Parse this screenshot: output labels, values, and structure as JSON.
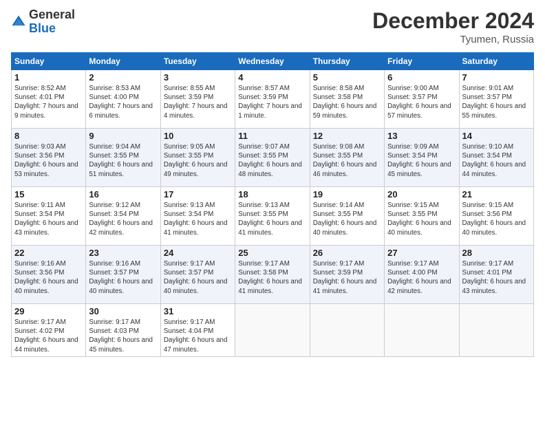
{
  "header": {
    "logo_general": "General",
    "logo_blue": "Blue",
    "month_title": "December 2024",
    "location": "Tyumen, Russia"
  },
  "days_of_week": [
    "Sunday",
    "Monday",
    "Tuesday",
    "Wednesday",
    "Thursday",
    "Friday",
    "Saturday"
  ],
  "weeks": [
    [
      {
        "day": "1",
        "sunrise": "8:52 AM",
        "sunset": "4:01 PM",
        "daylight": "7 hours and 9 minutes."
      },
      {
        "day": "2",
        "sunrise": "8:53 AM",
        "sunset": "4:00 PM",
        "daylight": "7 hours and 6 minutes."
      },
      {
        "day": "3",
        "sunrise": "8:55 AM",
        "sunset": "3:59 PM",
        "daylight": "7 hours and 4 minutes."
      },
      {
        "day": "4",
        "sunrise": "8:57 AM",
        "sunset": "3:59 PM",
        "daylight": "7 hours and 1 minute."
      },
      {
        "day": "5",
        "sunrise": "8:58 AM",
        "sunset": "3:58 PM",
        "daylight": "6 hours and 59 minutes."
      },
      {
        "day": "6",
        "sunrise": "9:00 AM",
        "sunset": "3:57 PM",
        "daylight": "6 hours and 57 minutes."
      },
      {
        "day": "7",
        "sunrise": "9:01 AM",
        "sunset": "3:57 PM",
        "daylight": "6 hours and 55 minutes."
      }
    ],
    [
      {
        "day": "8",
        "sunrise": "9:03 AM",
        "sunset": "3:56 PM",
        "daylight": "6 hours and 53 minutes."
      },
      {
        "day": "9",
        "sunrise": "9:04 AM",
        "sunset": "3:55 PM",
        "daylight": "6 hours and 51 minutes."
      },
      {
        "day": "10",
        "sunrise": "9:05 AM",
        "sunset": "3:55 PM",
        "daylight": "6 hours and 49 minutes."
      },
      {
        "day": "11",
        "sunrise": "9:07 AM",
        "sunset": "3:55 PM",
        "daylight": "6 hours and 48 minutes."
      },
      {
        "day": "12",
        "sunrise": "9:08 AM",
        "sunset": "3:55 PM",
        "daylight": "6 hours and 46 minutes."
      },
      {
        "day": "13",
        "sunrise": "9:09 AM",
        "sunset": "3:54 PM",
        "daylight": "6 hours and 45 minutes."
      },
      {
        "day": "14",
        "sunrise": "9:10 AM",
        "sunset": "3:54 PM",
        "daylight": "6 hours and 44 minutes."
      }
    ],
    [
      {
        "day": "15",
        "sunrise": "9:11 AM",
        "sunset": "3:54 PM",
        "daylight": "6 hours and 43 minutes."
      },
      {
        "day": "16",
        "sunrise": "9:12 AM",
        "sunset": "3:54 PM",
        "daylight": "6 hours and 42 minutes."
      },
      {
        "day": "17",
        "sunrise": "9:13 AM",
        "sunset": "3:54 PM",
        "daylight": "6 hours and 41 minutes."
      },
      {
        "day": "18",
        "sunrise": "9:13 AM",
        "sunset": "3:55 PM",
        "daylight": "6 hours and 41 minutes."
      },
      {
        "day": "19",
        "sunrise": "9:14 AM",
        "sunset": "3:55 PM",
        "daylight": "6 hours and 40 minutes."
      },
      {
        "day": "20",
        "sunrise": "9:15 AM",
        "sunset": "3:55 PM",
        "daylight": "6 hours and 40 minutes."
      },
      {
        "day": "21",
        "sunrise": "9:15 AM",
        "sunset": "3:56 PM",
        "daylight": "6 hours and 40 minutes."
      }
    ],
    [
      {
        "day": "22",
        "sunrise": "9:16 AM",
        "sunset": "3:56 PM",
        "daylight": "6 hours and 40 minutes."
      },
      {
        "day": "23",
        "sunrise": "9:16 AM",
        "sunset": "3:57 PM",
        "daylight": "6 hours and 40 minutes."
      },
      {
        "day": "24",
        "sunrise": "9:17 AM",
        "sunset": "3:57 PM",
        "daylight": "6 hours and 40 minutes."
      },
      {
        "day": "25",
        "sunrise": "9:17 AM",
        "sunset": "3:58 PM",
        "daylight": "6 hours and 41 minutes."
      },
      {
        "day": "26",
        "sunrise": "9:17 AM",
        "sunset": "3:59 PM",
        "daylight": "6 hours and 41 minutes."
      },
      {
        "day": "27",
        "sunrise": "9:17 AM",
        "sunset": "4:00 PM",
        "daylight": "6 hours and 42 minutes."
      },
      {
        "day": "28",
        "sunrise": "9:17 AM",
        "sunset": "4:01 PM",
        "daylight": "6 hours and 43 minutes."
      }
    ],
    [
      {
        "day": "29",
        "sunrise": "9:17 AM",
        "sunset": "4:02 PM",
        "daylight": "6 hours and 44 minutes."
      },
      {
        "day": "30",
        "sunrise": "9:17 AM",
        "sunset": "4:03 PM",
        "daylight": "6 hours and 45 minutes."
      },
      {
        "day": "31",
        "sunrise": "9:17 AM",
        "sunset": "4:04 PM",
        "daylight": "6 hours and 47 minutes."
      },
      null,
      null,
      null,
      null
    ]
  ]
}
